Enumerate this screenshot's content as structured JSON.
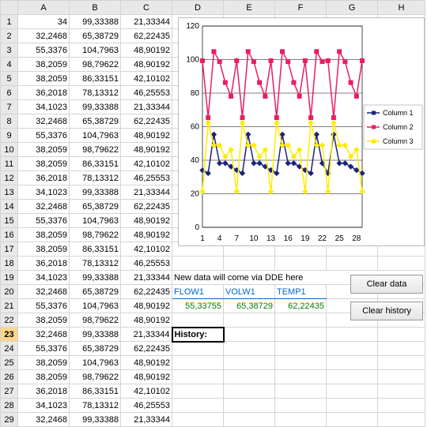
{
  "columns": [
    "A",
    "B",
    "C",
    "D",
    "E",
    "F",
    "G",
    "H"
  ],
  "rows": [
    {
      "n": 1,
      "c": [
        "34",
        "99,33388",
        "21,33344",
        "",
        "",
        "",
        "",
        ""
      ]
    },
    {
      "n": 2,
      "c": [
        "32,2468",
        "65,38729",
        "62,22435",
        "",
        "",
        "",
        "",
        ""
      ]
    },
    {
      "n": 3,
      "c": [
        "55,3376",
        "104,7963",
        "48,90192",
        "",
        "",
        "",
        "",
        ""
      ]
    },
    {
      "n": 4,
      "c": [
        "38,2059",
        "98,79622",
        "48,90192",
        "",
        "",
        "",
        "",
        ""
      ]
    },
    {
      "n": 5,
      "c": [
        "38,2059",
        "86,33151",
        "42,10102",
        "",
        "",
        "",
        "",
        ""
      ]
    },
    {
      "n": 6,
      "c": [
        "36,2018",
        "78,13312",
        "46,25553",
        "",
        "",
        "",
        "",
        ""
      ]
    },
    {
      "n": 7,
      "c": [
        "34,1023",
        "99,33388",
        "21,33344",
        "",
        "",
        "",
        "",
        ""
      ]
    },
    {
      "n": 8,
      "c": [
        "32,2468",
        "65,38729",
        "62,22435",
        "",
        "",
        "",
        "",
        ""
      ]
    },
    {
      "n": 9,
      "c": [
        "55,3376",
        "104,7963",
        "48,90192",
        "",
        "",
        "",
        "",
        ""
      ]
    },
    {
      "n": 10,
      "c": [
        "38,2059",
        "98,79622",
        "48,90192",
        "",
        "",
        "",
        "",
        ""
      ]
    },
    {
      "n": 11,
      "c": [
        "38,2059",
        "86,33151",
        "42,10102",
        "",
        "",
        "",
        "",
        ""
      ]
    },
    {
      "n": 12,
      "c": [
        "36,2018",
        "78,13312",
        "46,25553",
        "",
        "",
        "",
        "",
        ""
      ]
    },
    {
      "n": 13,
      "c": [
        "34,1023",
        "99,33388",
        "21,33344",
        "",
        "",
        "",
        "",
        ""
      ]
    },
    {
      "n": 14,
      "c": [
        "32,2468",
        "65,38729",
        "62,22435",
        "",
        "",
        "",
        "",
        ""
      ]
    },
    {
      "n": 15,
      "c": [
        "55,3376",
        "104,7963",
        "48,90192",
        "",
        "",
        "",
        "",
        ""
      ]
    },
    {
      "n": 16,
      "c": [
        "38,2059",
        "98,79622",
        "48,90192",
        "",
        "",
        "",
        "",
        ""
      ]
    },
    {
      "n": 17,
      "c": [
        "38,2059",
        "86,33151",
        "42,10102",
        "",
        "",
        "",
        "",
        ""
      ]
    },
    {
      "n": 18,
      "c": [
        "36,2018",
        "78,13312",
        "46,25553",
        "",
        "",
        "",
        "",
        ""
      ]
    },
    {
      "n": 19,
      "c": [
        "34,1023",
        "99,33388",
        "21,33344",
        "New data will come via DDE here",
        "",
        "",
        "",
        ""
      ]
    },
    {
      "n": 20,
      "c": [
        "32,2468",
        "65,38729",
        "62,22435",
        "FLOW1",
        "VOLW1",
        "TEMP1",
        "",
        ""
      ]
    },
    {
      "n": 21,
      "c": [
        "55,3376",
        "104,7963",
        "48,90192",
        "55,33755",
        "65,38729",
        "62,22435",
        "",
        ""
      ]
    },
    {
      "n": 22,
      "c": [
        "38,2059",
        "98,79622",
        "48,90192",
        "",
        "",
        "",
        "",
        ""
      ]
    },
    {
      "n": 23,
      "c": [
        "32,2468",
        "99,33388",
        "21,33344",
        "History:",
        "",
        "",
        "",
        ""
      ]
    },
    {
      "n": 24,
      "c": [
        "55,3376",
        "65,38729",
        "62,22435",
        "",
        "",
        "",
        "",
        ""
      ]
    },
    {
      "n": 25,
      "c": [
        "38,2059",
        "104,7963",
        "48,90192",
        "",
        "",
        "",
        "",
        ""
      ]
    },
    {
      "n": 26,
      "c": [
        "38,2059",
        "98,79622",
        "48,90192",
        "",
        "",
        "",
        "",
        ""
      ]
    },
    {
      "n": 27,
      "c": [
        "36,2018",
        "86,33151",
        "42,10102",
        "",
        "",
        "",
        "",
        ""
      ]
    },
    {
      "n": 28,
      "c": [
        "34,1023",
        "78,13312",
        "46,25553",
        "",
        "",
        "",
        "",
        ""
      ]
    },
    {
      "n": 29,
      "c": [
        "32,2468",
        "99,33388",
        "21,33344",
        "",
        "",
        "",
        "",
        ""
      ]
    }
  ],
  "buttons": {
    "clear_data": "Clear data",
    "clear_history": "Clear history"
  },
  "chart_data": {
    "type": "line",
    "x": [
      1,
      2,
      3,
      4,
      5,
      6,
      7,
      8,
      9,
      10,
      11,
      12,
      13,
      14,
      15,
      16,
      17,
      18,
      19,
      20,
      21,
      22,
      23,
      24,
      25,
      26,
      27,
      28,
      29
    ],
    "series": [
      {
        "name": "Column 1",
        "color": "#1a237e",
        "values": [
          34,
          32.25,
          55.34,
          38.21,
          38.21,
          36.2,
          34.1,
          32.25,
          55.34,
          38.21,
          38.21,
          36.2,
          34.1,
          32.25,
          55.34,
          38.21,
          38.21,
          36.2,
          34.1,
          32.25,
          55.34,
          38.21,
          32.25,
          55.34,
          38.21,
          38.21,
          36.2,
          34.1,
          32.25
        ]
      },
      {
        "name": "Column 2",
        "color": "#e91e63",
        "values": [
          99.33,
          65.39,
          104.8,
          98.8,
          86.33,
          78.13,
          99.33,
          65.39,
          104.8,
          98.8,
          86.33,
          78.13,
          99.33,
          65.39,
          104.8,
          98.8,
          86.33,
          78.13,
          99.33,
          65.39,
          104.8,
          98.8,
          99.33,
          65.39,
          104.8,
          98.8,
          86.33,
          78.13,
          99.33
        ]
      },
      {
        "name": "Column 3",
        "color": "#ffeb00",
        "values": [
          21.33,
          62.22,
          48.9,
          48.9,
          42.1,
          46.26,
          21.33,
          62.22,
          48.9,
          48.9,
          42.1,
          46.26,
          21.33,
          62.22,
          48.9,
          48.9,
          42.1,
          46.26,
          21.33,
          62.22,
          48.9,
          48.9,
          21.33,
          62.22,
          48.9,
          48.9,
          42.1,
          46.26,
          21.33
        ]
      }
    ],
    "ylim": [
      0,
      120
    ],
    "yticks": [
      0,
      20,
      40,
      60,
      80,
      100,
      120
    ],
    "xticks": [
      1,
      4,
      7,
      10,
      13,
      16,
      19,
      22,
      25,
      28
    ],
    "legend_pos": "right"
  }
}
